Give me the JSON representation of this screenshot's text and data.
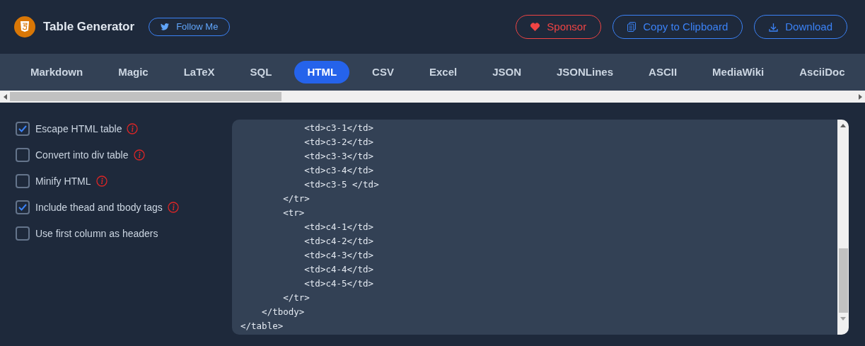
{
  "header": {
    "title": "Table Generator",
    "follow_button": "Follow Me",
    "actions": [
      {
        "kind": "sponsor",
        "label": "Sponsor"
      },
      {
        "kind": "copy",
        "label": "Copy to Clipboard"
      },
      {
        "kind": "download",
        "label": "Download"
      }
    ]
  },
  "tabs": [
    {
      "label": "Markdown",
      "selected": false
    },
    {
      "label": "Magic",
      "selected": false
    },
    {
      "label": "LaTeX",
      "selected": false
    },
    {
      "label": "SQL",
      "selected": false
    },
    {
      "label": "HTML",
      "selected": true
    },
    {
      "label": "CSV",
      "selected": false
    },
    {
      "label": "Excel",
      "selected": false
    },
    {
      "label": "JSON",
      "selected": false
    },
    {
      "label": "JSONLines",
      "selected": false
    },
    {
      "label": "ASCII",
      "selected": false
    },
    {
      "label": "MediaWiki",
      "selected": false
    },
    {
      "label": "AsciiDoc",
      "selected": false
    }
  ],
  "options": [
    {
      "label": "Escape HTML table",
      "checked": true,
      "info": true
    },
    {
      "label": "Convert into div table",
      "checked": false,
      "info": true
    },
    {
      "label": "Minify HTML",
      "checked": false,
      "info": true
    },
    {
      "label": "Include thead and tbody tags",
      "checked": true,
      "info": true
    },
    {
      "label": "Use first column as headers",
      "checked": false,
      "info": false
    }
  ],
  "code_lines": [
    "            <td>c3-1</td>",
    "            <td>c3-2</td>",
    "            <td>c3-3</td>",
    "            <td>c3-4</td>",
    "            <td>c3-5 </td>",
    "        </tr>",
    "        <tr>",
    "            <td>c4-1</td>",
    "            <td>c4-2</td>",
    "            <td>c4-3</td>",
    "            <td>c4-4</td>",
    "            <td>c4-5</td>",
    "        </tr>",
    "    </tbody>",
    "</table>"
  ]
}
